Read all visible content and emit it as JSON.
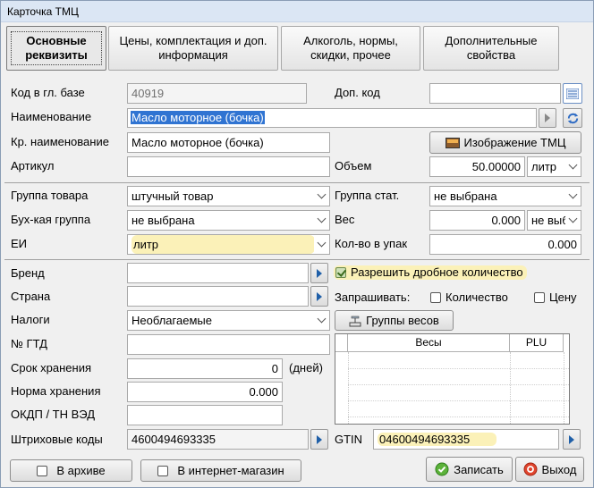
{
  "window": {
    "title": "Карточка ТМЦ"
  },
  "tabs": [
    {
      "label": "Основные реквизиты"
    },
    {
      "label": "Цены, комплектация и доп.  информация"
    },
    {
      "label": "Алкоголь, нормы, скидки, прочее"
    },
    {
      "label": "Дополнительные свойства"
    }
  ],
  "fields": {
    "code_label": "Код в гл. базе",
    "code_value": "40919",
    "extra_code_label": "Доп. код",
    "extra_code_value": "",
    "name_label": "Наименование",
    "name_value": "Масло моторное (бочка)",
    "short_name_label": "Кр. наименование",
    "short_name_value": "Масло моторное (бочка)",
    "image_button": "Изображение ТМЦ",
    "article_label": "Артикул",
    "article_value": "",
    "volume_label": "Объем",
    "volume_value": "50.00000",
    "volume_unit": "литр",
    "product_group_label": "Группа товара",
    "product_group_value": "штучный товар",
    "stat_group_label": "Группа стат.",
    "stat_group_value": "не выбрана",
    "acc_group_label": "Бух-кая группа",
    "acc_group_value": "не выбрана",
    "weight_label": "Вес",
    "weight_value": "0.000",
    "weight_unit": "не выб",
    "unit_label": "ЕИ",
    "unit_value": "литр",
    "pack_qty_label": "Кол-во в упак",
    "pack_qty_value": "0.000",
    "brand_label": "Бренд",
    "brand_value": "",
    "fractional_label": "Разрешить дробное количество",
    "country_label": "Страна",
    "country_value": "",
    "ask_label": "Запрашивать:",
    "ask_qty_label": "Количество",
    "ask_price_label": "Цену",
    "taxes_label": "Налоги",
    "taxes_value": "Необлагаемые",
    "weight_groups_button": "Группы весов",
    "gtd_label": "№ ГТД",
    "gtd_value": "",
    "shelf_life_label": "Срок хранения",
    "shelf_life_value": "0",
    "shelf_life_unit": "(дней)",
    "storage_norm_label": "Норма хранения",
    "storage_norm_value": "0.000",
    "okdp_label": "ОКДП / ТН ВЭД",
    "okdp_value": "",
    "barcodes_label": "Штриховые коды",
    "barcodes_value": "4600494693335",
    "gtin_label": "GTIN",
    "gtin_value": "04600494693335"
  },
  "scales_table": {
    "columns": [
      "Весы",
      "PLU"
    ]
  },
  "footer": {
    "archive_label": "В архиве",
    "eshop_label": "В интернет-магазин",
    "save_label": "Записать",
    "exit_label": "Выход"
  }
}
